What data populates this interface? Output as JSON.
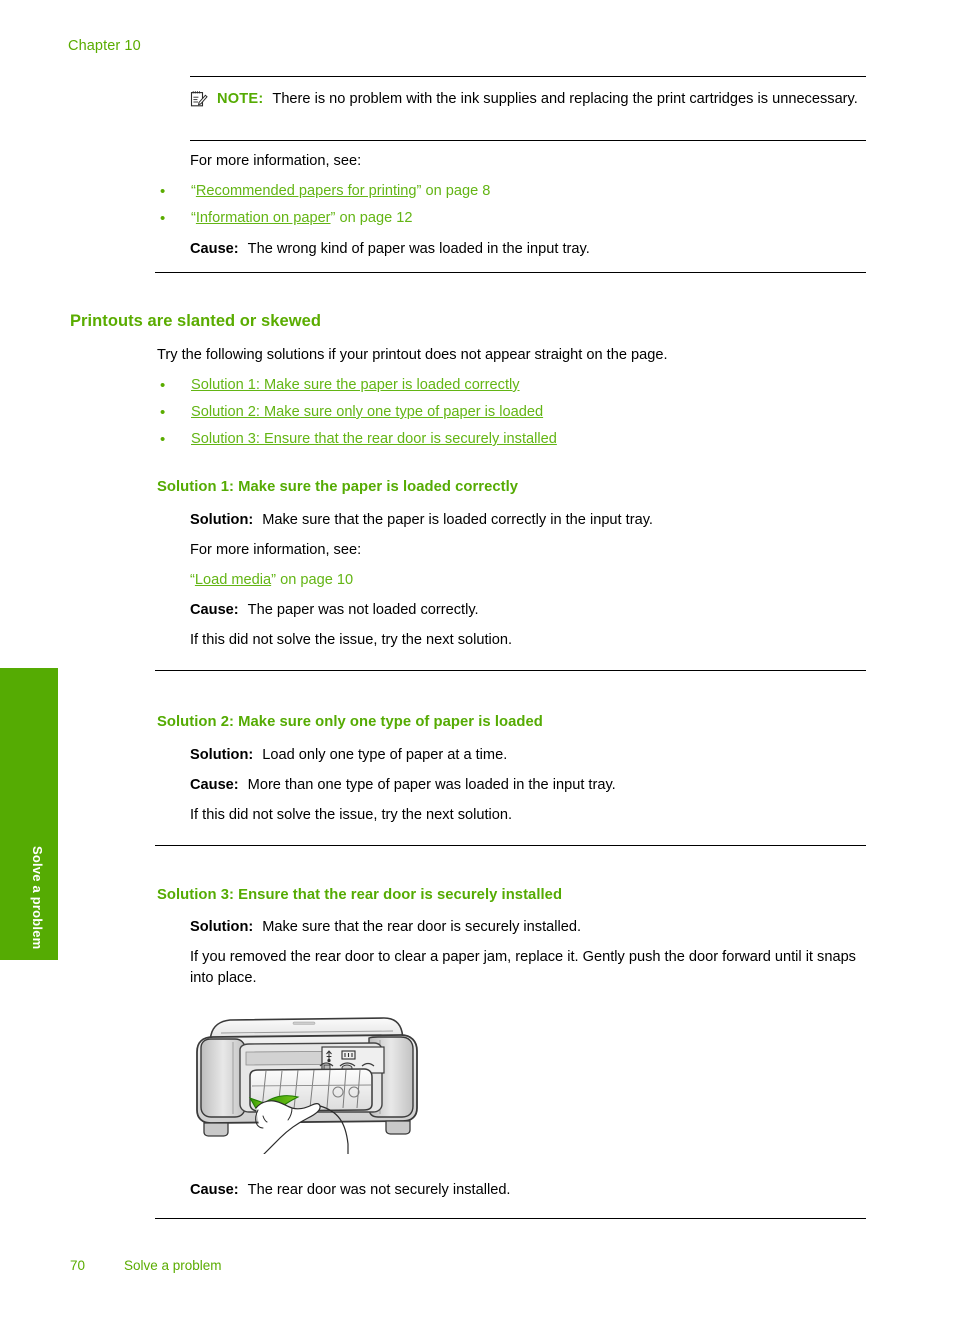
{
  "page": {
    "chapter_label": "Chapter 10",
    "side_tab_label": "Solve a problem",
    "footer_page_number": "70",
    "footer_section": "Solve a problem"
  },
  "note": {
    "icon": "note-pad-pencil-icon",
    "keyword": "NOTE:",
    "text": "There is no problem with the ink supplies and replacing the print cartridges is unnecessary."
  },
  "intro": {
    "for_more_info": "For more information, see:",
    "links": [
      {
        "quote_open": "“",
        "link": "Recommended papers for printing",
        "quote_close": "”",
        "suffix": " on page 8"
      },
      {
        "quote_open": "“",
        "link": "Information on paper",
        "quote_close": "”",
        "suffix": " on page 12"
      }
    ],
    "cause_label": "Cause:",
    "cause_text": "The wrong kind of paper was loaded in the input tray."
  },
  "section": {
    "title": "Printouts are slanted or skewed",
    "lead": "Try the following solutions if your printout does not appear straight on the page.",
    "toc": [
      "Solution 1: Make sure the paper is loaded correctly",
      "Solution 2: Make sure only one type of paper is loaded",
      "Solution 3: Ensure that the rear door is securely installed"
    ]
  },
  "solution1": {
    "heading": "Solution 1: Make sure the paper is loaded correctly",
    "solution_label": "Solution:",
    "solution_text": "Make sure that the paper is loaded correctly in the input tray.",
    "for_more_info": "For more information, see:",
    "link_quote_open": "“",
    "link": "Load media",
    "link_quote_close": "”",
    "link_suffix": " on page 10",
    "cause_label": "Cause:",
    "cause_text": "The paper was not loaded correctly.",
    "next": "If this did not solve the issue, try the next solution."
  },
  "solution2": {
    "heading": "Solution 2: Make sure only one type of paper is loaded",
    "solution_label": "Solution:",
    "solution_text": "Load only one type of paper at a time.",
    "cause_label": "Cause:",
    "cause_text": "More than one type of paper was loaded in the input tray.",
    "next": "If this did not solve the issue, try the next solution."
  },
  "solution3": {
    "heading": "Solution 3: Ensure that the rear door is securely installed",
    "solution_label": "Solution:",
    "solution_text": "Make sure that the rear door is securely installed.",
    "body": "If you removed the rear door to clear a paper jam, replace it. Gently push the door forward until it snaps into place.",
    "figure_alt": "printer-rear-door-illustration",
    "cause_label": "Cause:",
    "cause_text": "The rear door was not securely installed."
  },
  "colors": {
    "brand_green": "#55ab03",
    "heading_green": "#5aac00",
    "link_green": "#63b514",
    "tab_green": "#55ab03",
    "rule_black": "#000000"
  }
}
